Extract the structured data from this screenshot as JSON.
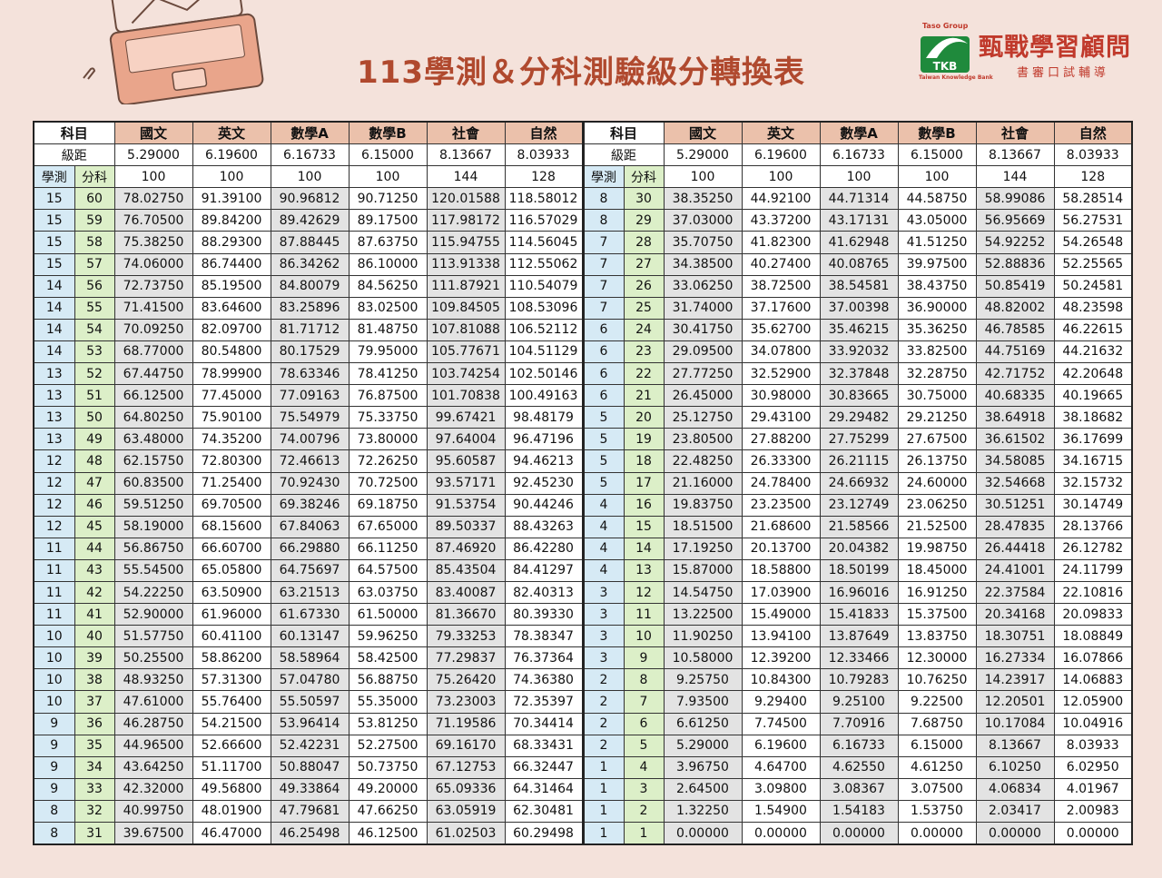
{
  "title": "113學測＆分科測驗級分轉換表",
  "logo": {
    "group": "Taso Group",
    "mark": "TKB",
    "subtitle": "Taiwan Knowledge Bank",
    "name": "甄戰學習顧問",
    "tagline": "書審口試輔導"
  },
  "table": {
    "subject_label": "科目",
    "step_label": "級距",
    "xuece_label": "學測",
    "fenke_label": "分科",
    "subjects": [
      "國文",
      "英文",
      "數學A",
      "數學B",
      "社會",
      "自然"
    ],
    "steps": [
      "5.29000",
      "6.19600",
      "6.16733",
      "6.15000",
      "8.13667",
      "8.03933"
    ],
    "fulls": [
      "100",
      "100",
      "100",
      "100",
      "144",
      "128"
    ],
    "left_rows": [
      [
        "15",
        "60",
        "78.02750",
        "91.39100",
        "90.96812",
        "90.71250",
        "120.01588",
        "118.58012"
      ],
      [
        "15",
        "59",
        "76.70500",
        "89.84200",
        "89.42629",
        "89.17500",
        "117.98172",
        "116.57029"
      ],
      [
        "15",
        "58",
        "75.38250",
        "88.29300",
        "87.88445",
        "87.63750",
        "115.94755",
        "114.56045"
      ],
      [
        "15",
        "57",
        "74.06000",
        "86.74400",
        "86.34262",
        "86.10000",
        "113.91338",
        "112.55062"
      ],
      [
        "14",
        "56",
        "72.73750",
        "85.19500",
        "84.80079",
        "84.56250",
        "111.87921",
        "110.54079"
      ],
      [
        "14",
        "55",
        "71.41500",
        "83.64600",
        "83.25896",
        "83.02500",
        "109.84505",
        "108.53096"
      ],
      [
        "14",
        "54",
        "70.09250",
        "82.09700",
        "81.71712",
        "81.48750",
        "107.81088",
        "106.52112"
      ],
      [
        "14",
        "53",
        "68.77000",
        "80.54800",
        "80.17529",
        "79.95000",
        "105.77671",
        "104.51129"
      ],
      [
        "13",
        "52",
        "67.44750",
        "78.99900",
        "78.63346",
        "78.41250",
        "103.74254",
        "102.50146"
      ],
      [
        "13",
        "51",
        "66.12500",
        "77.45000",
        "77.09163",
        "76.87500",
        "101.70838",
        "100.49163"
      ],
      [
        "13",
        "50",
        "64.80250",
        "75.90100",
        "75.54979",
        "75.33750",
        "99.67421",
        "98.48179"
      ],
      [
        "13",
        "49",
        "63.48000",
        "74.35200",
        "74.00796",
        "73.80000",
        "97.64004",
        "96.47196"
      ],
      [
        "12",
        "48",
        "62.15750",
        "72.80300",
        "72.46613",
        "72.26250",
        "95.60587",
        "94.46213"
      ],
      [
        "12",
        "47",
        "60.83500",
        "71.25400",
        "70.92430",
        "70.72500",
        "93.57171",
        "92.45230"
      ],
      [
        "12",
        "46",
        "59.51250",
        "69.70500",
        "69.38246",
        "69.18750",
        "91.53754",
        "90.44246"
      ],
      [
        "12",
        "45",
        "58.19000",
        "68.15600",
        "67.84063",
        "67.65000",
        "89.50337",
        "88.43263"
      ],
      [
        "11",
        "44",
        "56.86750",
        "66.60700",
        "66.29880",
        "66.11250",
        "87.46920",
        "86.42280"
      ],
      [
        "11",
        "43",
        "55.54500",
        "65.05800",
        "64.75697",
        "64.57500",
        "85.43504",
        "84.41297"
      ],
      [
        "11",
        "42",
        "54.22250",
        "63.50900",
        "63.21513",
        "63.03750",
        "83.40087",
        "82.40313"
      ],
      [
        "11",
        "41",
        "52.90000",
        "61.96000",
        "61.67330",
        "61.50000",
        "81.36670",
        "80.39330"
      ],
      [
        "10",
        "40",
        "51.57750",
        "60.41100",
        "60.13147",
        "59.96250",
        "79.33253",
        "78.38347"
      ],
      [
        "10",
        "39",
        "50.25500",
        "58.86200",
        "58.58964",
        "58.42500",
        "77.29837",
        "76.37364"
      ],
      [
        "10",
        "38",
        "48.93250",
        "57.31300",
        "57.04780",
        "56.88750",
        "75.26420",
        "74.36380"
      ],
      [
        "10",
        "37",
        "47.61000",
        "55.76400",
        "55.50597",
        "55.35000",
        "73.23003",
        "72.35397"
      ],
      [
        "9",
        "36",
        "46.28750",
        "54.21500",
        "53.96414",
        "53.81250",
        "71.19586",
        "70.34414"
      ],
      [
        "9",
        "35",
        "44.96500",
        "52.66600",
        "52.42231",
        "52.27500",
        "69.16170",
        "68.33431"
      ],
      [
        "9",
        "34",
        "43.64250",
        "51.11700",
        "50.88047",
        "50.73750",
        "67.12753",
        "66.32447"
      ],
      [
        "9",
        "33",
        "42.32000",
        "49.56800",
        "49.33864",
        "49.20000",
        "65.09336",
        "64.31464"
      ],
      [
        "8",
        "32",
        "40.99750",
        "48.01900",
        "47.79681",
        "47.66250",
        "63.05919",
        "62.30481"
      ],
      [
        "8",
        "31",
        "39.67500",
        "46.47000",
        "46.25498",
        "46.12500",
        "61.02503",
        "60.29498"
      ]
    ],
    "right_rows": [
      [
        "8",
        "30",
        "38.35250",
        "44.92100",
        "44.71314",
        "44.58750",
        "58.99086",
        "58.28514"
      ],
      [
        "8",
        "29",
        "37.03000",
        "43.37200",
        "43.17131",
        "43.05000",
        "56.95669",
        "56.27531"
      ],
      [
        "7",
        "28",
        "35.70750",
        "41.82300",
        "41.62948",
        "41.51250",
        "54.92252",
        "54.26548"
      ],
      [
        "7",
        "27",
        "34.38500",
        "40.27400",
        "40.08765",
        "39.97500",
        "52.88836",
        "52.25565"
      ],
      [
        "7",
        "26",
        "33.06250",
        "38.72500",
        "38.54581",
        "38.43750",
        "50.85419",
        "50.24581"
      ],
      [
        "7",
        "25",
        "31.74000",
        "37.17600",
        "37.00398",
        "36.90000",
        "48.82002",
        "48.23598"
      ],
      [
        "6",
        "24",
        "30.41750",
        "35.62700",
        "35.46215",
        "35.36250",
        "46.78585",
        "46.22615"
      ],
      [
        "6",
        "23",
        "29.09500",
        "34.07800",
        "33.92032",
        "33.82500",
        "44.75169",
        "44.21632"
      ],
      [
        "6",
        "22",
        "27.77250",
        "32.52900",
        "32.37848",
        "32.28750",
        "42.71752",
        "42.20648"
      ],
      [
        "6",
        "21",
        "26.45000",
        "30.98000",
        "30.83665",
        "30.75000",
        "40.68335",
        "40.19665"
      ],
      [
        "5",
        "20",
        "25.12750",
        "29.43100",
        "29.29482",
        "29.21250",
        "38.64918",
        "38.18682"
      ],
      [
        "5",
        "19",
        "23.80500",
        "27.88200",
        "27.75299",
        "27.67500",
        "36.61502",
        "36.17699"
      ],
      [
        "5",
        "18",
        "22.48250",
        "26.33300",
        "26.21115",
        "26.13750",
        "34.58085",
        "34.16715"
      ],
      [
        "5",
        "17",
        "21.16000",
        "24.78400",
        "24.66932",
        "24.60000",
        "32.54668",
        "32.15732"
      ],
      [
        "4",
        "16",
        "19.83750",
        "23.23500",
        "23.12749",
        "23.06250",
        "30.51251",
        "30.14749"
      ],
      [
        "4",
        "15",
        "18.51500",
        "21.68600",
        "21.58566",
        "21.52500",
        "28.47835",
        "28.13766"
      ],
      [
        "4",
        "14",
        "17.19250",
        "20.13700",
        "20.04382",
        "19.98750",
        "26.44418",
        "26.12782"
      ],
      [
        "4",
        "13",
        "15.87000",
        "18.58800",
        "18.50199",
        "18.45000",
        "24.41001",
        "24.11799"
      ],
      [
        "3",
        "12",
        "14.54750",
        "17.03900",
        "16.96016",
        "16.91250",
        "22.37584",
        "22.10816"
      ],
      [
        "3",
        "11",
        "13.22500",
        "15.49000",
        "15.41833",
        "15.37500",
        "20.34168",
        "20.09833"
      ],
      [
        "3",
        "10",
        "11.90250",
        "13.94100",
        "13.87649",
        "13.83750",
        "18.30751",
        "18.08849"
      ],
      [
        "3",
        "9",
        "10.58000",
        "12.39200",
        "12.33466",
        "12.30000",
        "16.27334",
        "16.07866"
      ],
      [
        "2",
        "8",
        "9.25750",
        "10.84300",
        "10.79283",
        "10.76250",
        "14.23917",
        "14.06883"
      ],
      [
        "2",
        "7",
        "7.93500",
        "9.29400",
        "9.25100",
        "9.22500",
        "12.20501",
        "12.05900"
      ],
      [
        "2",
        "6",
        "6.61250",
        "7.74500",
        "7.70916",
        "7.68750",
        "10.17084",
        "10.04916"
      ],
      [
        "2",
        "5",
        "5.29000",
        "6.19600",
        "6.16733",
        "6.15000",
        "8.13667",
        "8.03933"
      ],
      [
        "1",
        "4",
        "3.96750",
        "4.64700",
        "4.62550",
        "4.61250",
        "6.10250",
        "6.02950"
      ],
      [
        "1",
        "3",
        "2.64500",
        "3.09800",
        "3.08367",
        "3.07500",
        "4.06834",
        "4.01967"
      ],
      [
        "1",
        "2",
        "1.32250",
        "1.54900",
        "1.54183",
        "1.53750",
        "2.03417",
        "2.00983"
      ],
      [
        "1",
        "1",
        "0.00000",
        "0.00000",
        "0.00000",
        "0.00000",
        "0.00000",
        "0.00000"
      ]
    ]
  }
}
